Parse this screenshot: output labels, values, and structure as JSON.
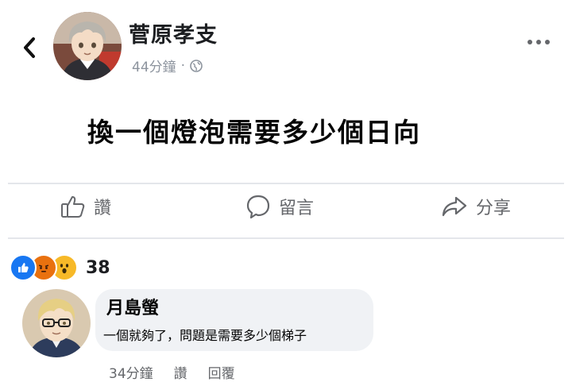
{
  "post": {
    "author": "菅原孝支",
    "time": "44分鐘",
    "separator": "·",
    "text": "換一個燈泡需要多少個日向"
  },
  "actions": {
    "like": "讚",
    "comment": "留言",
    "share": "分享"
  },
  "reactions": {
    "count": "38"
  },
  "comment": {
    "author": "月島螢",
    "text": "一個就夠了，問題是需要多少個梯子",
    "time": "34分鐘",
    "like": "讚",
    "reply": "回覆"
  }
}
